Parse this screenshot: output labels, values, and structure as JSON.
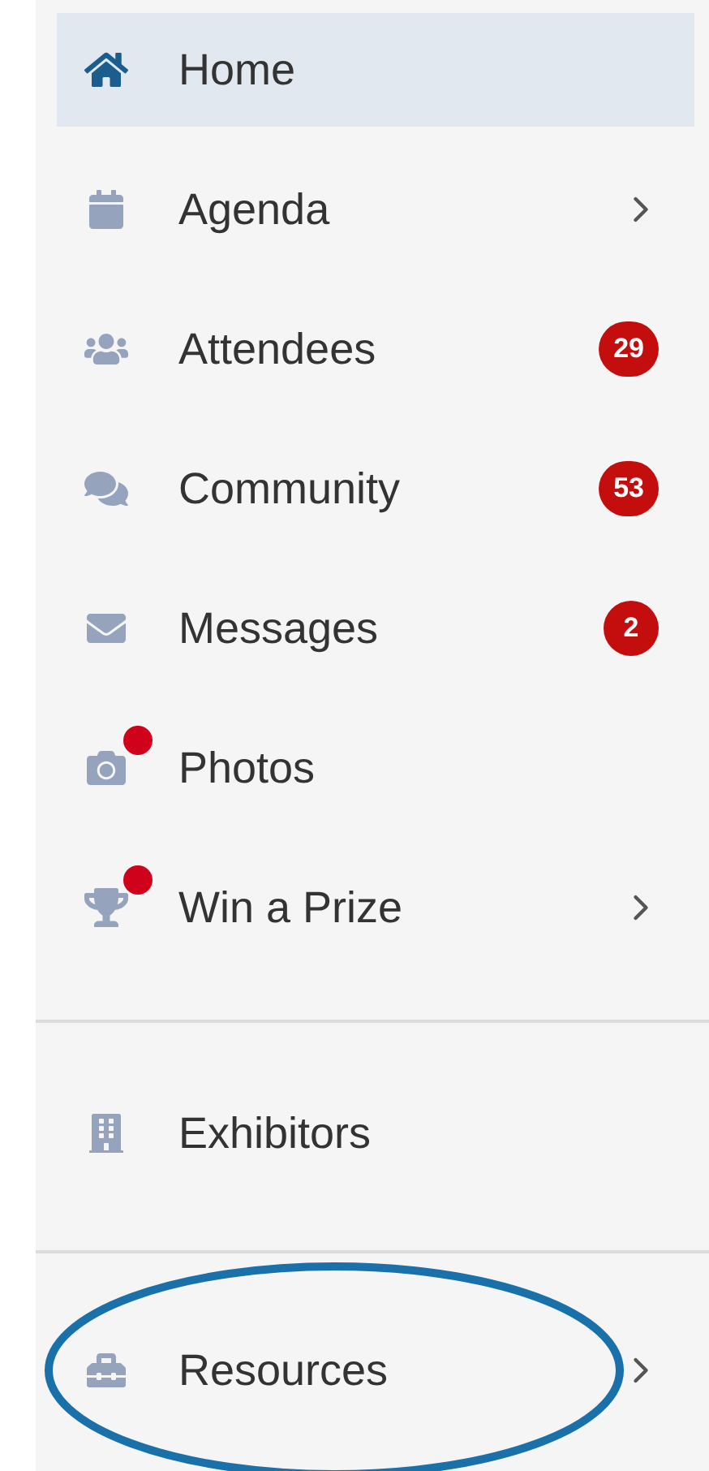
{
  "menu": {
    "groups": [
      {
        "items": [
          {
            "label": "Home",
            "selected": true,
            "dot": false,
            "chevron": false,
            "circled": false
          },
          {
            "label": "Agenda",
            "selected": false,
            "dot": false,
            "chevron": true,
            "circled": false
          },
          {
            "label": "Attendees",
            "selected": false,
            "dot": false,
            "chevron": false,
            "badge": "29",
            "circled": false
          },
          {
            "label": "Community",
            "selected": false,
            "dot": false,
            "chevron": false,
            "badge": "53",
            "circled": false
          },
          {
            "label": "Messages",
            "selected": false,
            "dot": false,
            "chevron": false,
            "badge": "2",
            "circled": false
          },
          {
            "label": "Photos",
            "selected": false,
            "dot": true,
            "chevron": false,
            "circled": false
          },
          {
            "label": "Win a Prize",
            "selected": false,
            "dot": true,
            "chevron": true,
            "circled": false
          }
        ]
      },
      {
        "items": [
          {
            "label": "Exhibitors",
            "selected": false,
            "dot": false,
            "chevron": false,
            "circled": false
          }
        ]
      },
      {
        "items": [
          {
            "label": "Resources",
            "selected": false,
            "dot": false,
            "chevron": true,
            "circled": true
          }
        ]
      }
    ]
  }
}
